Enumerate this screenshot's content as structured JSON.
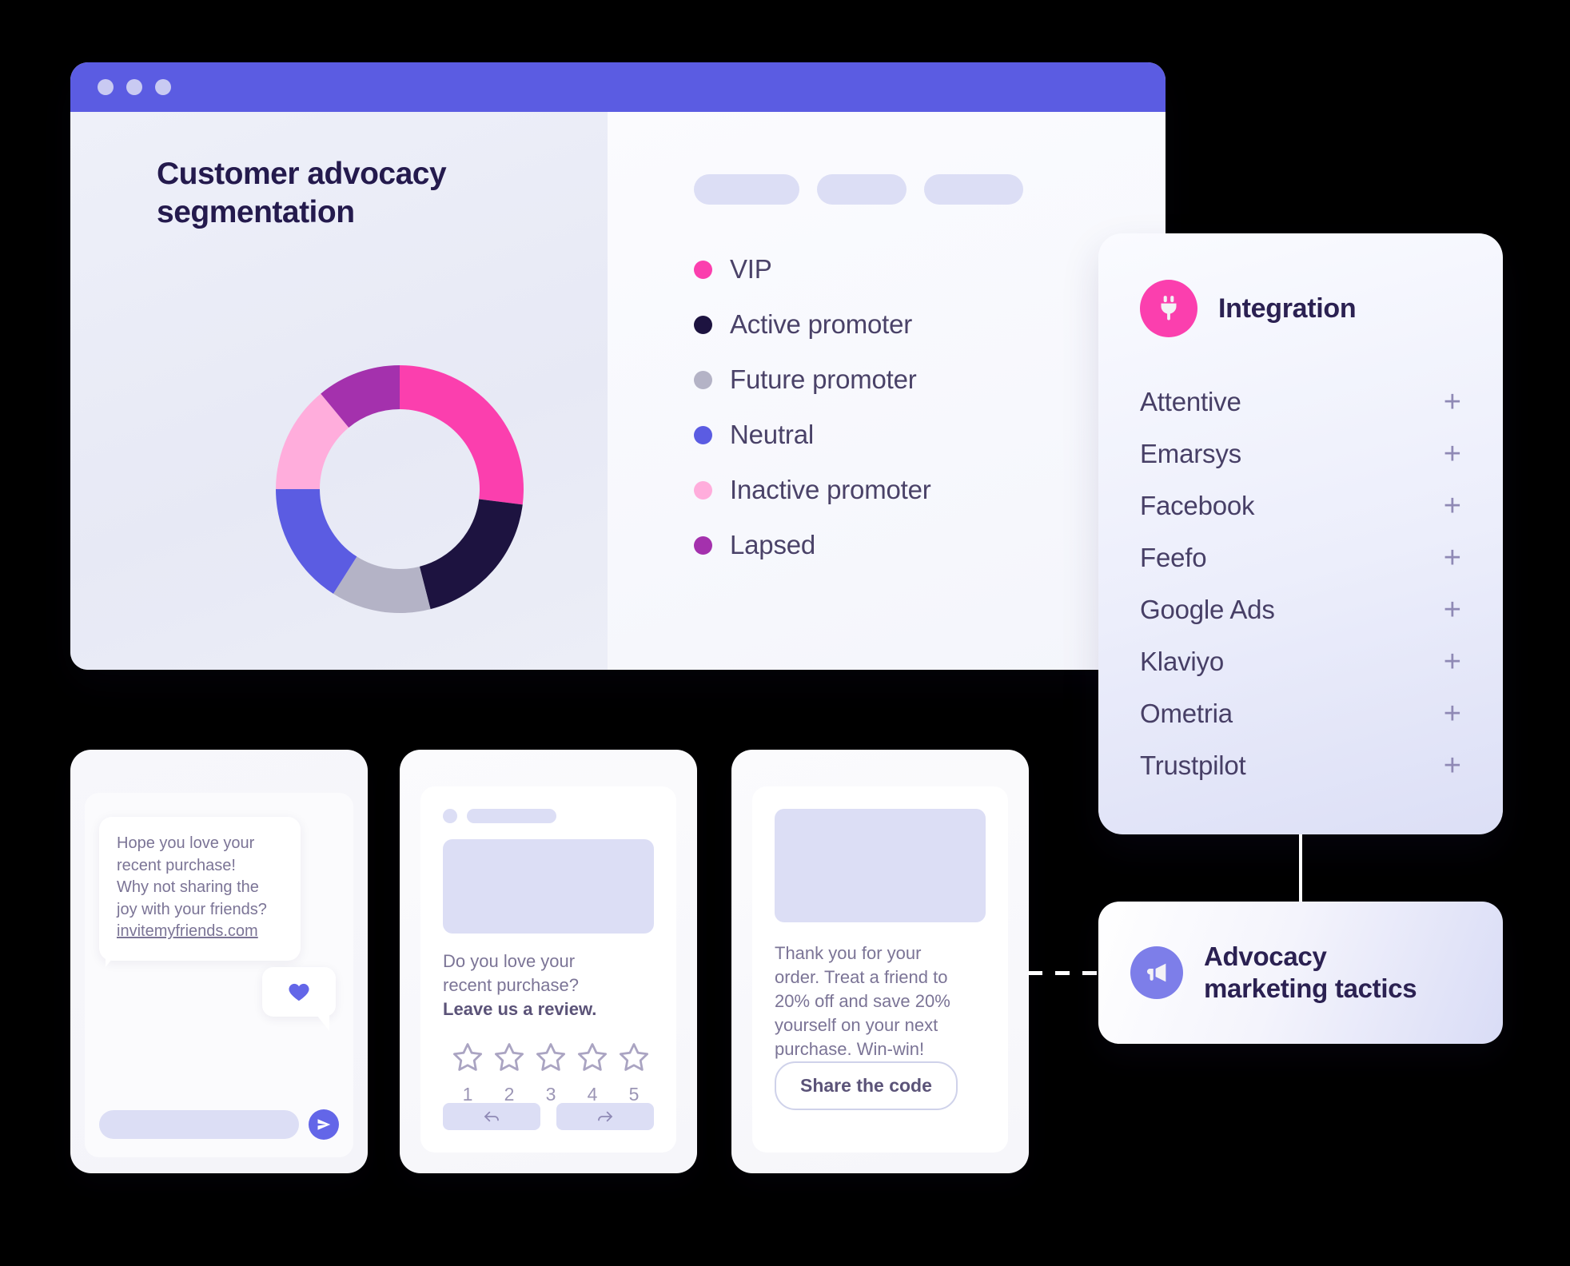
{
  "browser": {
    "chart_title": "Customer advocacy segmentation",
    "traffic_dots": [
      "dot-red",
      "dot-yellow",
      "dot-green"
    ],
    "placeholder_pills": [
      "pill-1",
      "pill-2",
      "pill-3"
    ]
  },
  "chart_data": {
    "type": "pie",
    "title": "Customer advocacy segmentation",
    "subtype": "donut",
    "legend_position": "right",
    "categories": [
      "VIP",
      "Active promoter",
      "Future promoter",
      "Neutral",
      "Inactive promoter",
      "Lapsed"
    ],
    "values": [
      27,
      19,
      13,
      16,
      14,
      11
    ],
    "colors": [
      "#fb3fae",
      "#1d1340",
      "#b4b3c6",
      "#5b5ce2",
      "#ffaddc",
      "#a431ad"
    ],
    "xlabel": "",
    "ylabel": ""
  },
  "legend": {
    "items": [
      {
        "label": "VIP",
        "color": "#fb3fae"
      },
      {
        "label": "Active promoter",
        "color": "#1d1340"
      },
      {
        "label": "Future promoter",
        "color": "#b4b3c6"
      },
      {
        "label": "Neutral",
        "color": "#5b5ce2"
      },
      {
        "label": "Inactive promoter",
        "color": "#ffaddc"
      },
      {
        "label": "Lapsed",
        "color": "#a431ad"
      }
    ]
  },
  "integration": {
    "title": "Integration",
    "icon": "plug-icon",
    "accent_color": "#fb3fae",
    "add_label": "+",
    "items": [
      {
        "name": "Attentive"
      },
      {
        "name": "Emarsys"
      },
      {
        "name": "Facebook"
      },
      {
        "name": "Feefo"
      },
      {
        "name": "Google Ads"
      },
      {
        "name": "Klaviyo"
      },
      {
        "name": "Ometria"
      },
      {
        "name": "Trustpilot"
      }
    ]
  },
  "sms_card": {
    "message_line1": "Hope you love your",
    "message_line2": "recent purchase!",
    "message_line3": "Why not sharing the",
    "message_line4": "joy with your friends?",
    "link": "invitemyfriends.com",
    "heart_icon": "heart-icon",
    "send_icon": "send-icon"
  },
  "review_card": {
    "text_line1": "Do you love your",
    "text_line2": "recent purchase?",
    "text_bold": "Leave us a review.",
    "star_icon": "star-outline-icon",
    "star_numbers": [
      "1",
      "2",
      "3",
      "4",
      "5"
    ],
    "reply_icon": "reply-icon",
    "forward_icon": "forward-icon"
  },
  "promo_card": {
    "text_line1": "Thank you for your",
    "text_line2": "order. Treat a friend to",
    "text_line3": "20% off and save 20%",
    "text_line4": "yourself on your next",
    "text_line5": "purchase. Win-win!",
    "button_label": "Share the code"
  },
  "advocacy": {
    "title_line1": "Advocacy",
    "title_line2": "marketing tactics",
    "icon": "megaphone-icon",
    "accent_color": "#7d7ee9"
  }
}
